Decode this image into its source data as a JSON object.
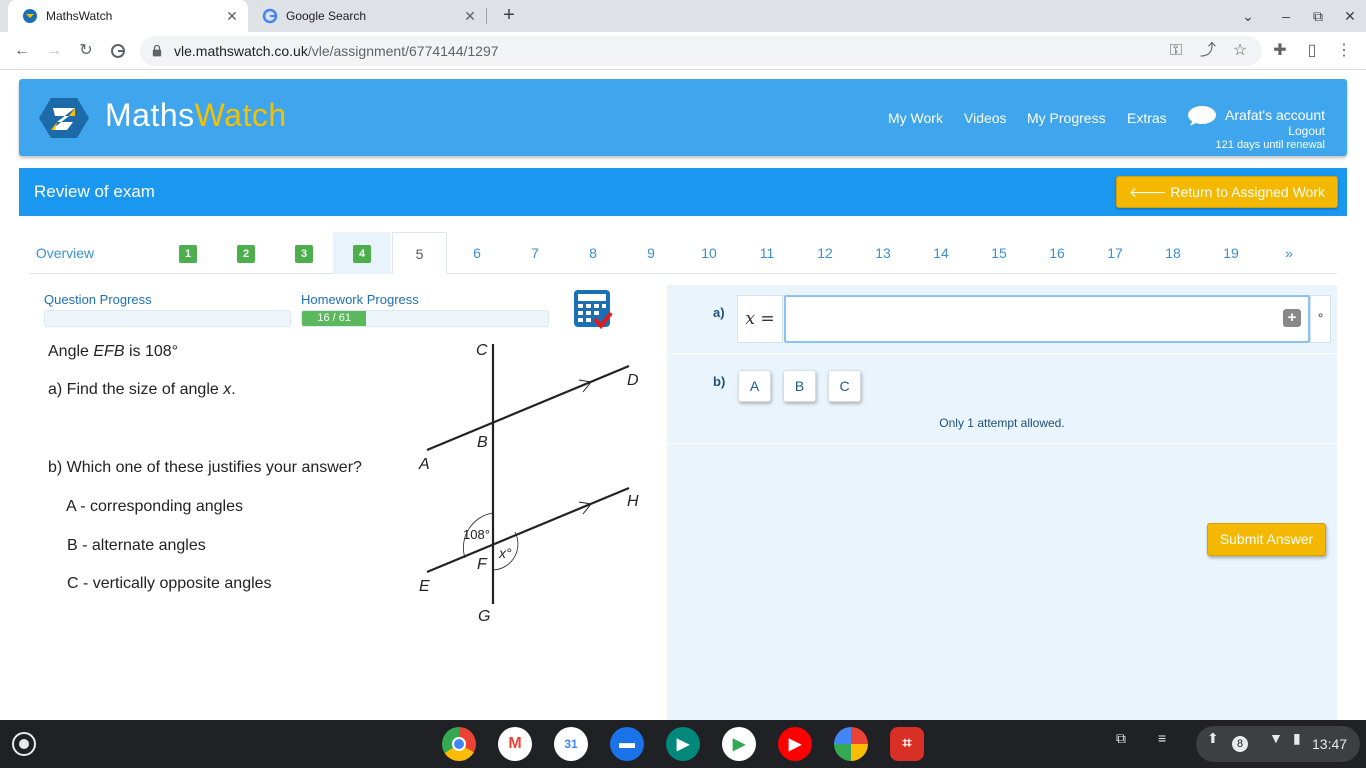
{
  "browser": {
    "tabs": [
      {
        "title": "MathsWatch",
        "active": true
      },
      {
        "title": "Google Search",
        "active": false
      }
    ],
    "url_domain": "vle.mathswatch.co.uk",
    "url_path": "/vle/assignment/6774144/1297"
  },
  "header": {
    "logo_main": "Maths",
    "logo_accent": "Watch",
    "nav": [
      "My Work",
      "Videos",
      "My Progress",
      "Extras"
    ],
    "account_name": "Arafat's account",
    "logout": "Logout",
    "renewal": "121 days until renewal"
  },
  "review": {
    "title": "Review of exam",
    "return_label": "Return to Assigned Work"
  },
  "question_tabs": {
    "overview": "Overview",
    "completed": [
      "1",
      "2",
      "3",
      "4"
    ],
    "current": "5",
    "pending": [
      "6",
      "7",
      "8",
      "9",
      "10",
      "11",
      "12",
      "13",
      "14",
      "15",
      "16",
      "17",
      "18",
      "19"
    ],
    "next": "»"
  },
  "progress": {
    "question_label": "Question Progress",
    "question_fraction": 0.0,
    "homework_label": "Homework Progress",
    "homework_text": "16 / 61",
    "homework_fraction": 0.262
  },
  "question": {
    "line1_prefix": "Angle ",
    "line1_angle": "EFB",
    "line1_suffix": " is 108°",
    "part_a_prefix": "a) Find the size of angle ",
    "part_a_var": "x",
    "part_a_suffix": ".",
    "part_b": "b) Which one of these justifies your answer?",
    "options": [
      "A - corresponding angles",
      "B - alternate angles",
      "C - vertically opposite angles"
    ]
  },
  "diagram": {
    "labels": {
      "C": "C",
      "D": "D",
      "A": "A",
      "B": "B",
      "H": "H",
      "E": "E",
      "F": "F",
      "G": "G"
    },
    "angle_given": "108°",
    "angle_unknown": "x°"
  },
  "answer": {
    "part_a_label": "a)",
    "x_eq": "x =",
    "input_value": "",
    "plus": "+",
    "degree": "°",
    "part_b_label": "b)",
    "choices": [
      "A",
      "B",
      "C"
    ],
    "attempt_note": "Only 1 attempt allowed.",
    "submit_label": "Submit Answer"
  },
  "shelf": {
    "notification_count": "8",
    "time": "13:47"
  },
  "colors": {
    "header_blue": "#3fa5ec",
    "review_blue": "#1a98f0",
    "accent_yellow": "#f5b800",
    "done_green": "#4cae4c"
  }
}
